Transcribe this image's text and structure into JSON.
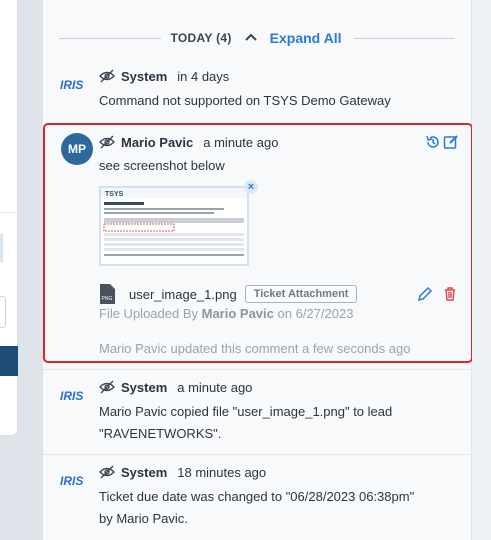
{
  "timeline": {
    "day_label": "TODAY (4)",
    "expand_label": "Expand All"
  },
  "entries": [
    {
      "author": "System",
      "time": "in 4 days",
      "text": "Command not supported on TSYS Demo Gateway"
    },
    {
      "author": "Mario Pavic",
      "initials": "MP",
      "time": "a minute ago",
      "text": "see screenshot below",
      "attachment": {
        "file_name": "user_image_1.png",
        "tag": "Ticket Attachment",
        "file_type": "PNG",
        "uploaded_prefix": "File Uploaded By",
        "uploaded_by": "Mario Pavic",
        "uploaded_on": "on 6/27/2023"
      },
      "updated_note": "Mario Pavic updated this comment a few seconds ago"
    },
    {
      "author": "System",
      "time": "a minute ago",
      "text_line1": "Mario Pavic copied file \"user_image_1.png\" to lead",
      "text_line2": "\"RAVENETWORKS\"."
    },
    {
      "author": "System",
      "time": "18 minutes ago",
      "text_line1": "Ticket due date was changed to \"06/28/2023 06:38pm\"",
      "text_line2": "by Mario Pavic."
    }
  ],
  "colors": {
    "accent": "#2a7ad6",
    "highlight_border": "#d9262b",
    "avatar_bg": "#2c6a9e",
    "delete": "#e0454a"
  }
}
